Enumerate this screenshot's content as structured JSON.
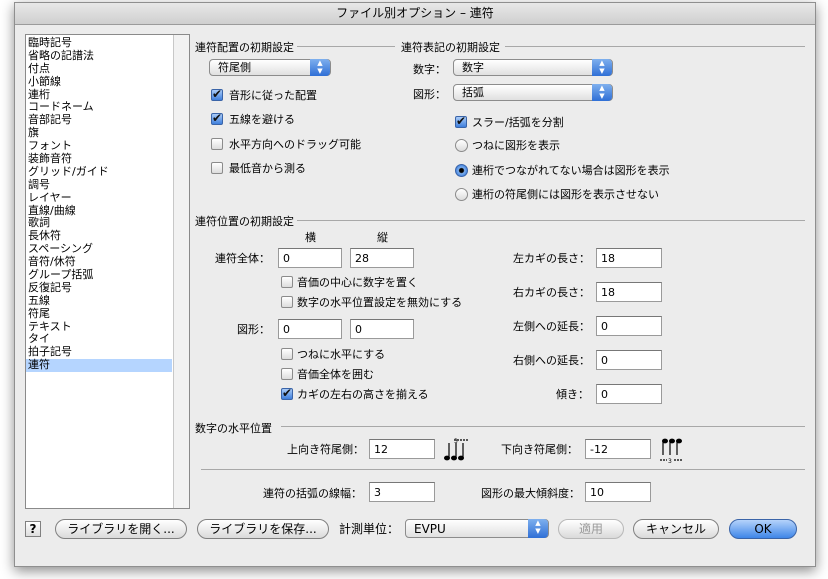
{
  "window": {
    "title": "ファイル別オプション – 連符"
  },
  "sidebar": {
    "items": [
      "臨時記号",
      "省略の記譜法",
      "付点",
      "小節線",
      "連桁",
      "コードネーム",
      "音部記号",
      "旗",
      "フォント",
      "装飾音符",
      "グリッド/ガイド",
      "調号",
      "レイヤー",
      "直線/曲線",
      "歌詞",
      "長休符",
      "スペーシング",
      "音符/休符",
      "グループ括弧",
      "反復記号",
      "五線",
      "符尾",
      "テキスト",
      "タイ",
      "拍子記号",
      "連符"
    ],
    "selected": "連符"
  },
  "placement": {
    "title": "連符配置の初期設定",
    "position_popup": "符尾側",
    "opts": {
      "match_shape": "音形に従った配置",
      "avoid_staff": "五線を避ける",
      "allow_horiz_drag": "水平方向へのドラッグ可能",
      "measure_from_lowest": "最低音から測る"
    }
  },
  "appearance": {
    "title": "連符表記の初期設定",
    "number_label": "数字：",
    "number_popup": "数字",
    "shape_label": "図形：",
    "shape_popup": "括弧",
    "break_slur": "スラー/括弧を分割",
    "radios": {
      "always_shape": "つねに図形を表示",
      "not_beamed": "連桁でつながれてない場合は図形を表示",
      "never_stem_side": "連桁の符尾側には図形を表示させない"
    }
  },
  "position": {
    "title": "連符位置の初期設定",
    "col_h": "横",
    "col_v": "縦",
    "whole_label": "連符全体：",
    "whole_h": "0",
    "whole_v": "28",
    "center_number": "音価の中心に数字を置く",
    "ignore_horiz": "数字の水平位置設定を無効にする",
    "shape_label": "図形：",
    "shape_h": "0",
    "shape_v": "0",
    "always_flat": "つねに水平にする",
    "full_duration": "音価全体を囲む",
    "match_hooks": "カギの左右の高さを揃える",
    "left_hook_label": "左カギの長さ：",
    "left_hook": "18",
    "right_hook_label": "右カギの長さ：",
    "right_hook": "18",
    "left_ext_label": "左側への延長：",
    "left_ext": "0",
    "right_ext_label": "右側への延長：",
    "right_ext": "0",
    "slope_label": "傾き：",
    "slope": "0"
  },
  "number_horiz": {
    "title": "数字の水平位置",
    "up_label": "上向き符尾側：",
    "up_value": "12",
    "down_label": "下向き符尾側：",
    "down_value": "-12",
    "icon_number": "3"
  },
  "bracket": {
    "width_label": "連符の括弧の線幅：",
    "width_value": "3",
    "max_slope_label": "図形の最大傾斜度：",
    "max_slope_value": "10"
  },
  "footer": {
    "help": "?",
    "open_library": "ライブラリを開く...",
    "save_library": "ライブラリを保存...",
    "units_label": "計測単位：",
    "units_value": "EVPU",
    "apply": "適用",
    "cancel": "キャンセル",
    "ok": "OK"
  }
}
